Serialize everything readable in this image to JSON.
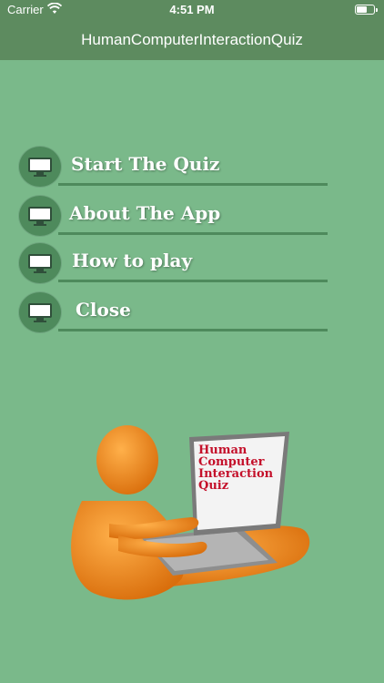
{
  "status_bar": {
    "carrier": "Carrier",
    "time": "4:51 PM",
    "wifi_icon": "wifi-icon",
    "battery_icon": "battery-icon",
    "battery_level": 0.6
  },
  "nav": {
    "title": "HumanComputerInteractionQuiz"
  },
  "menu": {
    "items": [
      {
        "label": "Start The Quiz",
        "icon": "monitor-icon"
      },
      {
        "label": "About The App",
        "icon": "monitor-icon"
      },
      {
        "label": "How to play",
        "icon": "monitor-icon"
      },
      {
        "label": "Close",
        "icon": "monitor-icon"
      }
    ]
  },
  "illustration": {
    "screen_lines": [
      "Human",
      "Computer",
      "Interaction",
      "Quiz"
    ]
  },
  "colors": {
    "nav_background": "#5d8b5f",
    "content_background": "#7ab98a",
    "accent": "#4e8a5c",
    "screen_text": "#c4102a",
    "figure": "#f28a1a"
  }
}
